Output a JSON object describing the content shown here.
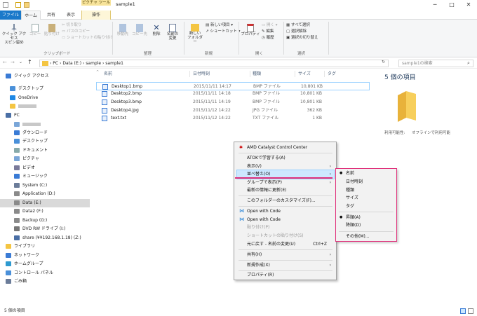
{
  "titlebar": {
    "context_tab": "ピクチャ ツール",
    "title": "sample1",
    "minimize": "─",
    "maximize": "□",
    "close": "✕"
  },
  "tabs": {
    "file": "ファイル",
    "home": "ホーム",
    "share": "共有",
    "view": "表示",
    "manage": "操作"
  },
  "ribbon": {
    "pin": "クイック アクセス\nスピン留め",
    "copy": "コピー",
    "paste": "貼り付け",
    "cut": "切り取り",
    "copy_path": "パスのコピー",
    "paste_shortcut": "ショートカットの貼り付け",
    "move_to": "移動先",
    "copy_to": "コピー先",
    "delete": "削除",
    "rename": "名前の\n変更",
    "new_folder": "新しい\nフォルダー",
    "new_item": "新しい項目 ▾",
    "shortcut": "ショートカット ▾",
    "properties": "プロパティ",
    "open": "開く ▾",
    "edit": "編集",
    "history": "履歴",
    "select_all": "すべて選択",
    "select_none": "選択解除",
    "invert": "選択の切り替え",
    "grp_clipboard": "クリップボード",
    "grp_organize": "整理",
    "grp_new": "新規",
    "grp_open": "開く",
    "grp_select": "選択"
  },
  "address": {
    "path": "›  PC  ›  Data (E:)  ›  sample  ›  sample1",
    "search_placeholder": "sample1の検索"
  },
  "nav": [
    {
      "label": "クイック アクセス"
    },
    {
      "label": "デスクトップ"
    },
    {
      "label": "OneDrive"
    },
    {
      "label": ""
    },
    {
      "label": "PC"
    },
    {
      "label": ""
    },
    {
      "label": "ダウンロード"
    },
    {
      "label": "デスクトップ"
    },
    {
      "label": "ドキュメント"
    },
    {
      "label": "ピクチャ"
    },
    {
      "label": "ビデオ"
    },
    {
      "label": "ミュージック"
    },
    {
      "label": "System (C:)"
    },
    {
      "label": "Application (D:)"
    },
    {
      "label": "Data (E:)"
    },
    {
      "label": "Data2 (F:)"
    },
    {
      "label": "Backup (G:)"
    },
    {
      "label": "DVD RW ドライブ (I:)"
    },
    {
      "label": "share (¥¥192.168.1.18) (Z:)"
    },
    {
      "label": "ライブラリ"
    },
    {
      "label": "ネットワーク"
    },
    {
      "label": "ホームグループ"
    },
    {
      "label": "コントロール パネル"
    },
    {
      "label": "ごみ箱"
    }
  ],
  "columns": {
    "name": "名前",
    "date": "日付時刻",
    "type": "種類",
    "size": "サイズ",
    "tag": "タグ"
  },
  "files": [
    {
      "name": "Desktop1.bmp",
      "date": "2015/11/11 14:17",
      "type": "BMP ファイル",
      "size": "10,801 KB"
    },
    {
      "name": "Desktop2.bmp",
      "date": "2015/11/11 14:18",
      "type": "BMP ファイル",
      "size": "10,801 KB"
    },
    {
      "name": "Desktop3.bmp",
      "date": "2015/11/11 14:19",
      "type": "BMP ファイル",
      "size": "10,801 KB"
    },
    {
      "name": "Desktop4.jpg",
      "date": "2015/11/12 14:22",
      "type": "JPG ファイル",
      "size": "362 KB"
    },
    {
      "name": "text.txt",
      "date": "2015/11/12 14:22",
      "type": "TXT ファイル",
      "size": "1 KB"
    }
  ],
  "preview": {
    "title": "5 個の項目",
    "avail_label": "利用可能性:",
    "avail_value": "オフラインで利用可能"
  },
  "status": {
    "count": "5 個の項目"
  },
  "context_menu": {
    "amd": "AMD Catalyst Control Center",
    "atok": "ATOKで学習する(A)",
    "view": "表示(V)",
    "sort": "並べ替え(O)",
    "group": "グループで表示(P)",
    "refresh": "最新の情報に更新(E)",
    "customize": "このフォルダーのカスタマイズ(F)...",
    "open_code1": "Open with Code",
    "open_code2": "Open with Code",
    "paste": "貼り付け(P)",
    "paste_shortcut": "ショートカットの貼り付け(S)",
    "undo": "元に戻す - 名前の変更(U)",
    "undo_key": "Ctrl+Z",
    "share": "共有(H)",
    "new": "新規作成(X)",
    "properties": "プロパティ(R)",
    "arrow": "›"
  },
  "submenu": {
    "name": "名前",
    "date": "日付時刻",
    "type": "種類",
    "size": "サイズ",
    "tag": "タグ",
    "asc": "昇順(A)",
    "desc": "降順(D)",
    "more": "その他(M)...",
    "bullet": "●"
  },
  "colors": {
    "accent": "#1979ca",
    "highlight": "#e0307a",
    "selection": "#cce8ff"
  }
}
